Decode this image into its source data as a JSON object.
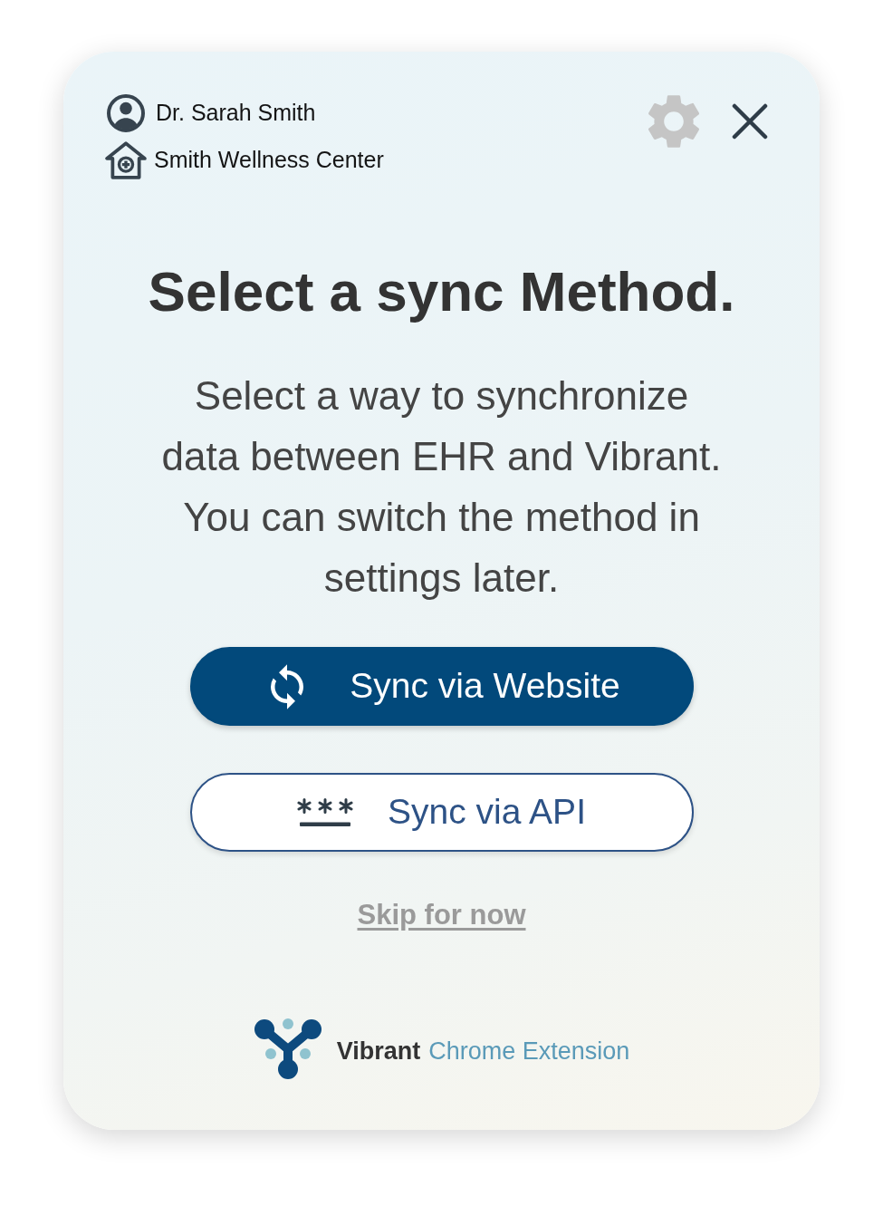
{
  "header": {
    "user": "Dr. Sarah Smith",
    "organization": "Smith Wellness Center"
  },
  "title": "Select a sync Method.",
  "description": "Select a way to synchronize data between EHR and Vibrant. You can switch the method in settings later.",
  "sync_options": [
    {
      "kind": "filled",
      "label": "Sync via Website"
    },
    {
      "kind": "outline",
      "label": "Sync via API"
    }
  ],
  "skip_link": "Skip for now",
  "footer": {
    "brand": "Vibrant",
    "product": "Chrome Extension"
  }
}
